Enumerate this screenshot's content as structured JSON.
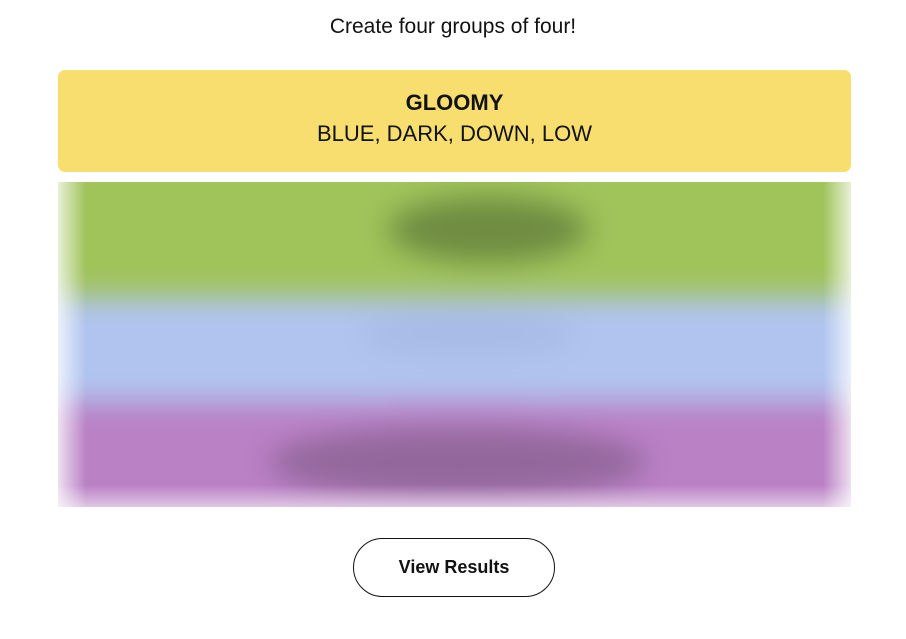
{
  "prompt": "Create four groups of four!",
  "solved_group": {
    "title": "GLOOMY",
    "members": "BLUE, DARK, DOWN, LOW",
    "color": "#f7de6f"
  },
  "hidden_rows": [
    {
      "name": "green",
      "color": "#a0c35a",
      "shade": "#5f7a3a"
    },
    {
      "name": "blue",
      "color": "#b0c4ef",
      "shade": "#98abd6"
    },
    {
      "name": "purple",
      "color": "#ba81c5",
      "shade": "#7a5680"
    }
  ],
  "actions": {
    "view_results_label": "View Results"
  }
}
